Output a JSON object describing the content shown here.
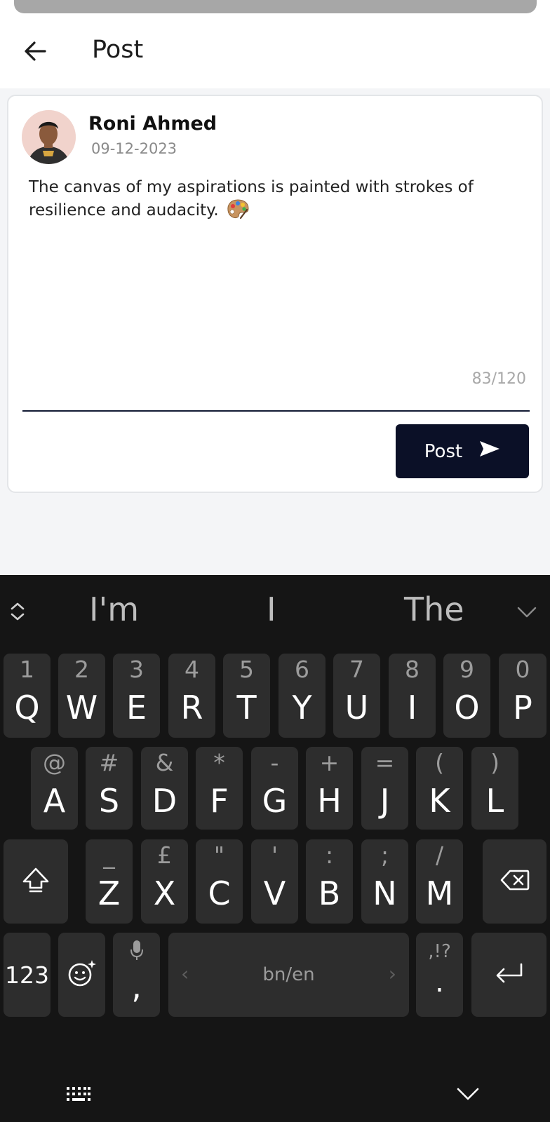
{
  "appbar": {
    "title": "Post",
    "back_icon": "arrow-left-icon"
  },
  "post": {
    "author": "Roni Ahmed",
    "date": "09-12-2023",
    "text": "The canvas of my aspirations is painted with strokes of resilience and audacity.",
    "emoji_icon": "artist-palette-icon",
    "counter": "83/120",
    "button_label": "Post",
    "button_icon": "send-icon"
  },
  "keyboard": {
    "suggestions": [
      "I'm",
      "I",
      "The"
    ],
    "row1": [
      {
        "hint": "1",
        "key": "Q"
      },
      {
        "hint": "2",
        "key": "W"
      },
      {
        "hint": "3",
        "key": "E"
      },
      {
        "hint": "4",
        "key": "R"
      },
      {
        "hint": "5",
        "key": "T"
      },
      {
        "hint": "6",
        "key": "Y"
      },
      {
        "hint": "7",
        "key": "U"
      },
      {
        "hint": "8",
        "key": "I"
      },
      {
        "hint": "9",
        "key": "O"
      },
      {
        "hint": "0",
        "key": "P"
      }
    ],
    "row2": [
      {
        "hint": "@",
        "key": "A"
      },
      {
        "hint": "#",
        "key": "S"
      },
      {
        "hint": "&",
        "key": "D"
      },
      {
        "hint": "*",
        "key": "F"
      },
      {
        "hint": "-",
        "key": "G"
      },
      {
        "hint": "+",
        "key": "H"
      },
      {
        "hint": "=",
        "key": "J"
      },
      {
        "hint": "(",
        "key": "K"
      },
      {
        "hint": ")",
        "key": "L"
      }
    ],
    "row3": [
      {
        "hint": "_",
        "key": "Z"
      },
      {
        "hint": "£",
        "key": "X"
      },
      {
        "hint": "\"",
        "key": "C"
      },
      {
        "hint": "'",
        "key": "V"
      },
      {
        "hint": ":",
        "key": "B"
      },
      {
        "hint": ";",
        "key": "N"
      },
      {
        "hint": "/",
        "key": "M"
      }
    ],
    "num_key": "123",
    "comma_key": ",",
    "space_label": "bn/en",
    "period_hint": ",!?",
    "period_key": ".",
    "colors": {
      "background": "#151515",
      "key": "#2d2d2d",
      "accent": "#0b1027"
    }
  }
}
